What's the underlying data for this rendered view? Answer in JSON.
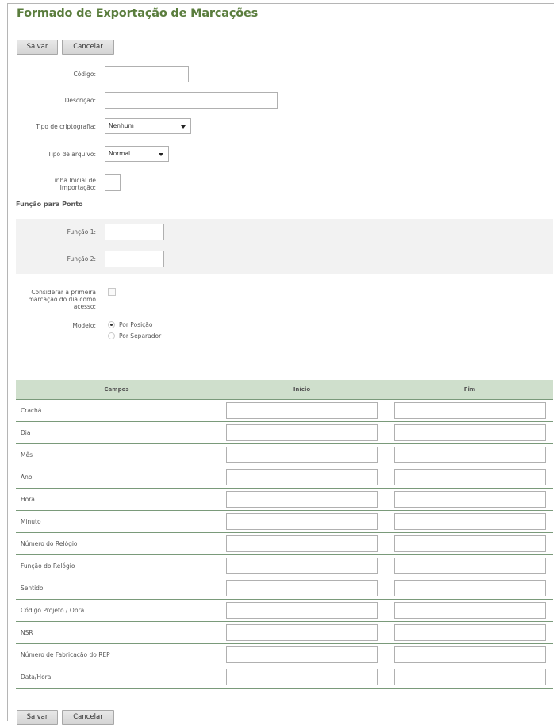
{
  "title": "Formado de Exportação de Marcações",
  "buttons": {
    "save": "Salvar",
    "cancel": "Cancelar"
  },
  "form": {
    "codigo": {
      "label": "Código:",
      "value": ""
    },
    "descricao": {
      "label": "Descrição:",
      "value": ""
    },
    "cripto": {
      "label": "Tipo de criptografia:",
      "value": "Nenhum"
    },
    "arquivo": {
      "label": "Tipo de arquivo:",
      "value": "Normal"
    },
    "linha_inicial": {
      "label_line1": "Linha Inicial de",
      "label_line2": "Importação:"
    },
    "funcao_section": "Função para Ponto",
    "funcao1": {
      "label": "Função 1:",
      "value": ""
    },
    "funcao2": {
      "label": "Função 2:",
      "value": ""
    },
    "considerar": {
      "line1": "Considerar a primeira",
      "line2": "marcação do dia como",
      "line3": "acesso:",
      "checked": false
    },
    "modelo": {
      "label": "Modelo:",
      "options": [
        {
          "label": "Por Posição",
          "checked": true
        },
        {
          "label": "Por Separador",
          "checked": false
        }
      ]
    }
  },
  "table": {
    "headers": [
      "Campos",
      "Início",
      "Fim"
    ],
    "rows": [
      "Crachá",
      "Dia",
      "Mês",
      "Ano",
      "Hora",
      "Minuto",
      "Número do Relógio",
      "Função do Relógio",
      "Sentido",
      "Código Projeto / Obra",
      "NSR",
      "Número de Fabricação do REP",
      "Data/Hora"
    ]
  },
  "colors": {
    "title": "#5a7d3d",
    "table_header_bg": "#cfdfcc",
    "row_border": "#7a9a7a"
  }
}
